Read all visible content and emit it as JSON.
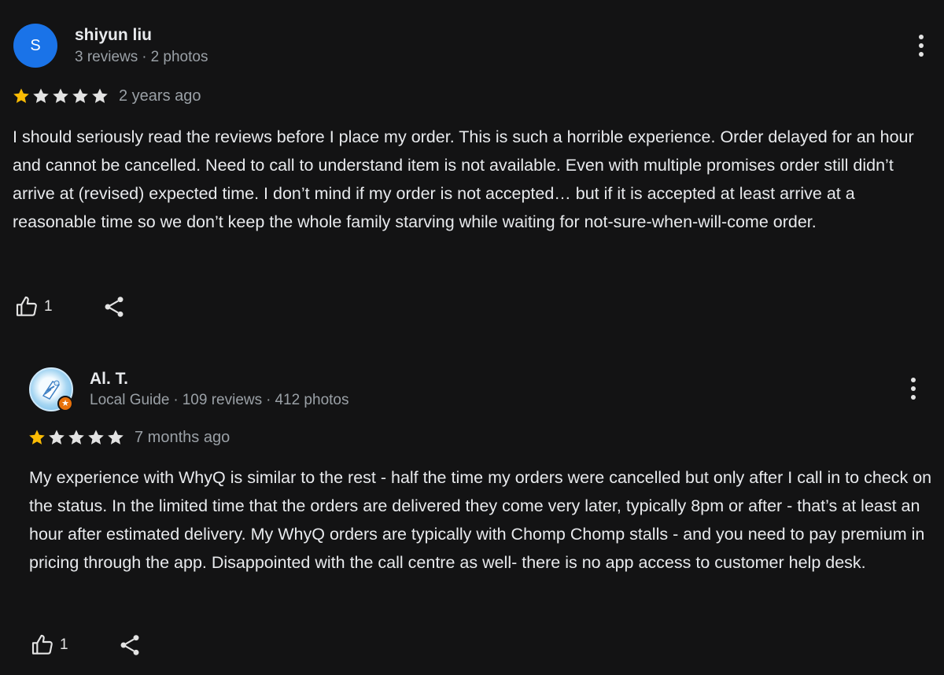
{
  "colors": {
    "background": "#131314",
    "star_filled": "#fbbc04",
    "star_empty": "#e3e3e3",
    "avatar_blue": "#1a73e8",
    "guide_badge": "#e8710a"
  },
  "reviews": [
    {
      "avatar_letter": "S",
      "author": "shiyun liu",
      "meta": [
        "3 reviews",
        "2 photos"
      ],
      "rating": 1,
      "max_rating": 5,
      "time": "2 years ago",
      "text": "I should seriously read the reviews before I place my order. This is such a horrible experience. Order delayed for an hour and cannot be cancelled. Need to call to understand item is not available. Even with multiple promises order still didn’t arrive at (revised) expected time. I don’t mind if my order is not accepted… but if it is accepted at least arrive at a reasonable time so we don’t keep the whole family starving while waiting for not-sure-when-will-come order.",
      "likes": "1",
      "icons": {
        "like": "thumbs-up-icon",
        "share": "share-icon",
        "more": "more-vert-icon"
      }
    },
    {
      "avatar_letter": "",
      "author": "Al. T.",
      "meta": [
        "Local Guide",
        "109 reviews",
        "412 photos"
      ],
      "rating": 1,
      "max_rating": 5,
      "time": "7 months ago",
      "text": "My experience with WhyQ is similar to the rest - half the time my orders were cancelled but only after I call in to check on the status. In the limited time that the orders are delivered they come very later, typically 8pm or after - that’s at least an hour after estimated delivery. My WhyQ orders are typically with Chomp Chomp stalls - and you need to pay premium in pricing through the app. Disappointed with the call centre as well- there is no app access to customer help desk.",
      "likes": "1",
      "icons": {
        "like": "thumbs-up-icon",
        "share": "share-icon",
        "more": "more-vert-icon",
        "badge": "local-guide-star-icon"
      }
    }
  ]
}
